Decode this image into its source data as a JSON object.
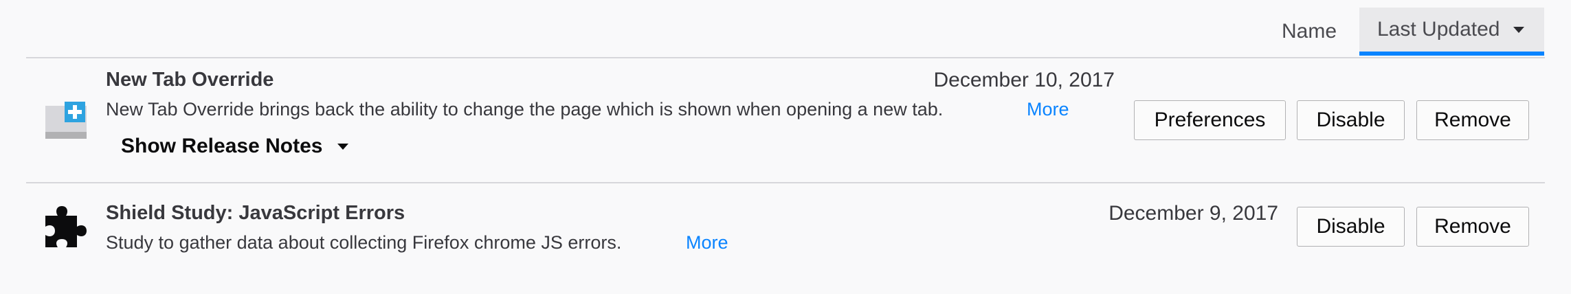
{
  "sort": {
    "name_label": "Name",
    "updated_label": "Last Updated",
    "active": "Last Updated"
  },
  "addons": [
    {
      "name": "New Tab Override",
      "date": "December 10, 2017",
      "description": "New Tab Override brings back the ability to change the page which is shown when opening a new tab.",
      "more_label": "More",
      "release_notes_label": "Show Release Notes",
      "buttons": {
        "preferences": "Preferences",
        "disable": "Disable",
        "remove": "Remove"
      },
      "icon": "new-tab-override-icon"
    },
    {
      "name": "Shield Study: JavaScript Errors",
      "date": "December 9, 2017",
      "description": "Study to gather data about collecting Firefox chrome JS errors.",
      "more_label": "More",
      "buttons": {
        "disable": "Disable",
        "remove": "Remove"
      },
      "icon": "puzzle-piece-icon"
    }
  ],
  "colors": {
    "accent": "#0a84ff",
    "background": "#f9f9fa",
    "active_sort_bg": "#e9e9eb"
  }
}
